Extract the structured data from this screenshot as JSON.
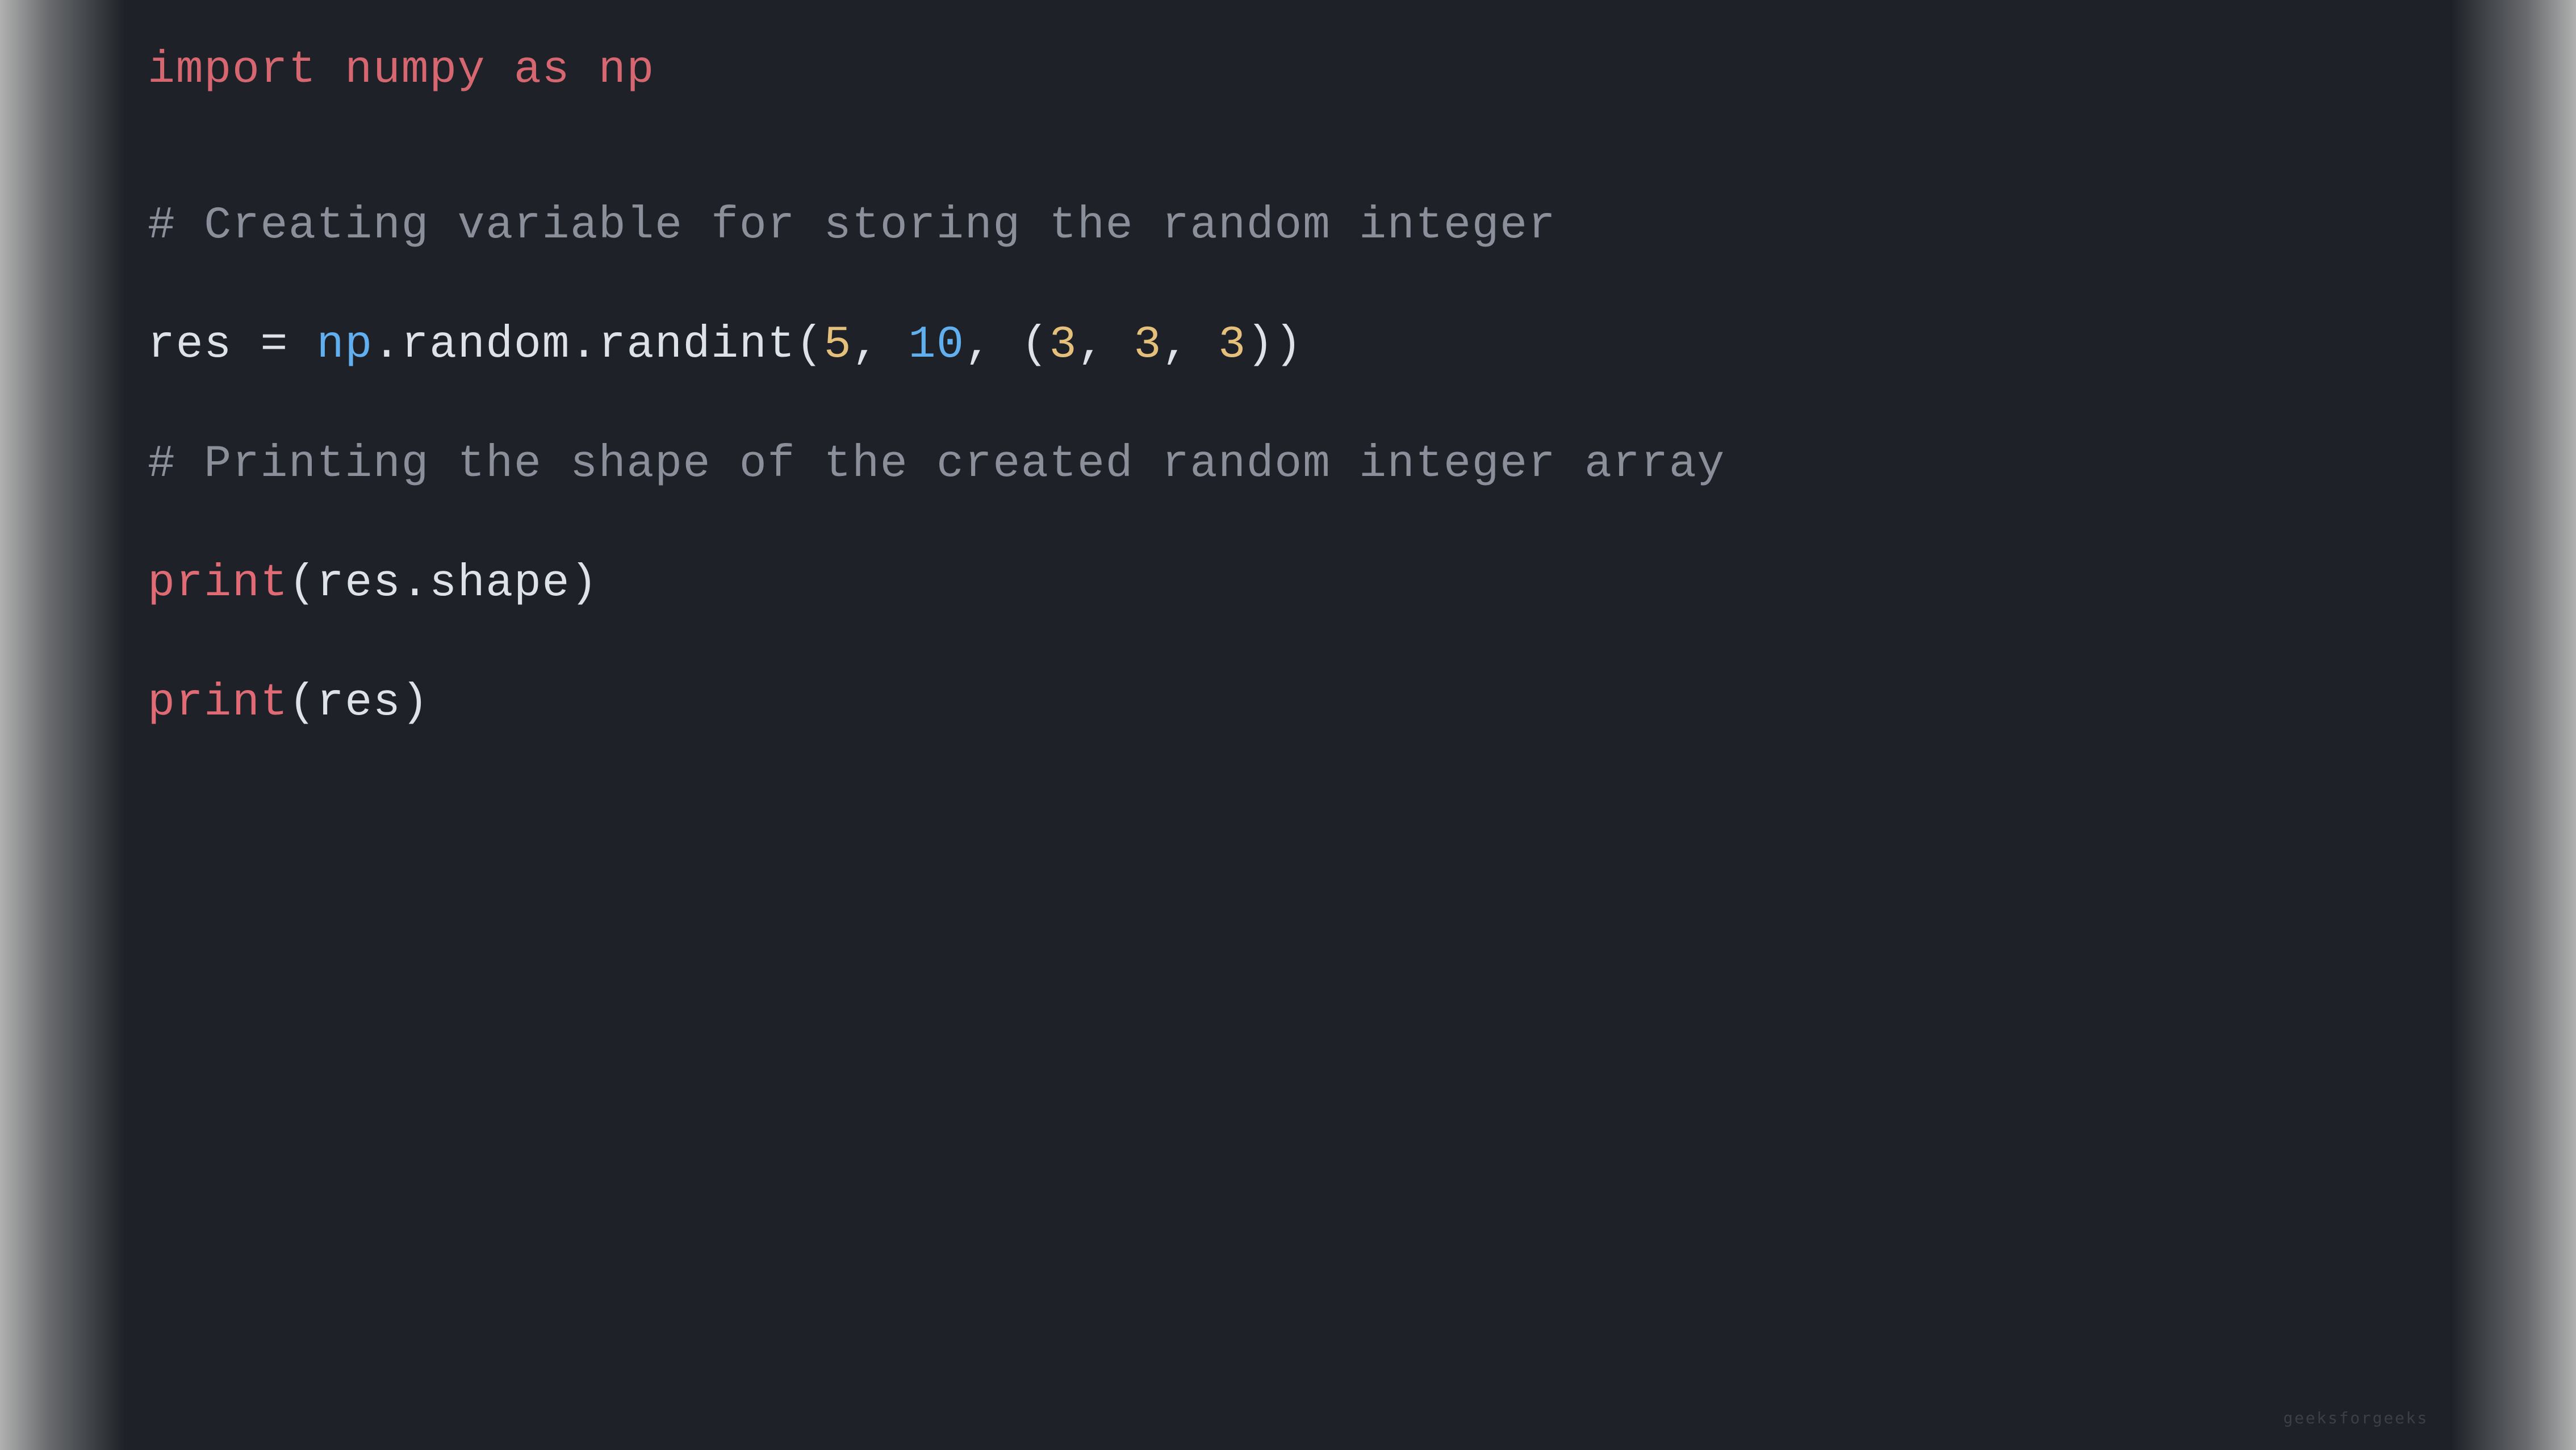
{
  "code": {
    "top_line": "import numpy as np",
    "comment1": "# Creating variable for storing the random integer",
    "code_line1_var": "res",
    "code_line1_op": " = ",
    "code_line1_np": "np",
    "code_line1_method": ".random.randint(",
    "code_line1_n1": "5",
    "code_line1_sep1": ", ",
    "code_line1_n2": "10",
    "code_line1_sep2": ", (",
    "code_line1_n3": "3",
    "code_line1_sep3": ", ",
    "code_line1_n4": "3",
    "code_line1_sep4": ", ",
    "code_line1_n5": "3",
    "code_line1_end": "))",
    "comment2": "# Printing the shape of the created random integer array",
    "code_line2_print": "print",
    "code_line2_content": "(res.shape)",
    "code_line3_print": "print",
    "code_line3_content": "(res)",
    "watermark": "geeksforgeeks"
  }
}
